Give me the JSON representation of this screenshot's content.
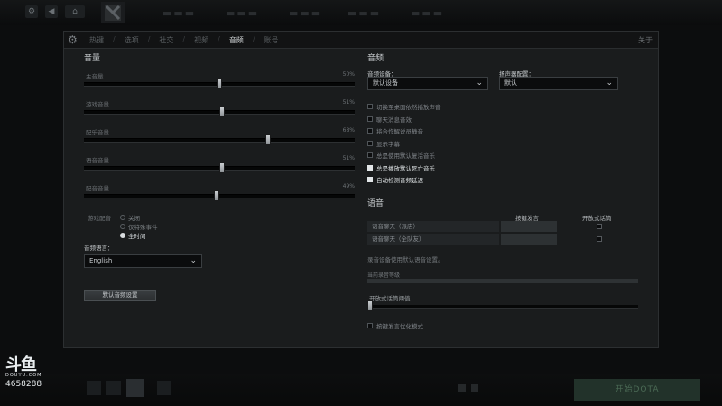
{
  "panel": {
    "tabs": [
      "热键",
      "选项",
      "社交",
      "视频",
      "音频",
      "账号"
    ],
    "active_tab": "音频",
    "close_label": "关于"
  },
  "volume": {
    "title": "音量",
    "sliders": [
      {
        "label": "主音量",
        "value": "50%",
        "level": 0.5
      },
      {
        "label": "游戏音量",
        "value": "51%",
        "level": 0.51
      },
      {
        "label": "配乐音量",
        "value": "68%",
        "level": 0.68
      },
      {
        "label": "语音音量",
        "value": "51%",
        "level": 0.51
      },
      {
        "label": "配音音量",
        "value": "49%",
        "level": 0.49
      }
    ],
    "voiceover_label": "游戏配音",
    "voiceover_options": [
      "关闭",
      "仅特殊事件",
      "全时间"
    ],
    "voiceover_selected": 2,
    "language_label": "音频语言：",
    "language_value": "English",
    "reset_button": "默认音频设置"
  },
  "audio": {
    "title": "音频",
    "device_label": "音频设备：",
    "device_value": "默认设备",
    "speaker_label": "扬声器配置：",
    "speaker_value": "默认",
    "options": [
      {
        "label": "切换至桌面依然播放声音",
        "checked": false
      },
      {
        "label": "聊天消息音效",
        "checked": false
      },
      {
        "label": "将合作解说员静音",
        "checked": false
      },
      {
        "label": "显示字幕",
        "checked": false
      },
      {
        "label": "总是使用默认复活音乐",
        "checked": false
      },
      {
        "label": "总是播放默认死亡音乐",
        "checked": true
      },
      {
        "label": "自动检测音频延迟",
        "checked": true
      }
    ]
  },
  "voice": {
    "title": "语音",
    "col_ptt": "按键发言",
    "col_open": "开放式话筒",
    "rows": [
      {
        "label": "语音聊天（派店）"
      },
      {
        "label": "语音聊天（全队友）"
      }
    ],
    "note": "录音设备使用默认语音设置。",
    "level_label": "当前录音等级",
    "threshold_label": "开放式话筒阈值",
    "enhanced_label": "按键发言优化模式"
  },
  "overlay": {
    "brand": "斗鱼",
    "brand_sub": "DOUYU.COM",
    "room": "4658288",
    "play_label": "开始DOTA"
  },
  "colors": {
    "panel_bg": "#1a1c1d",
    "accent_text": "#c8cccf",
    "checkbox_on": "#e2e6e8"
  }
}
